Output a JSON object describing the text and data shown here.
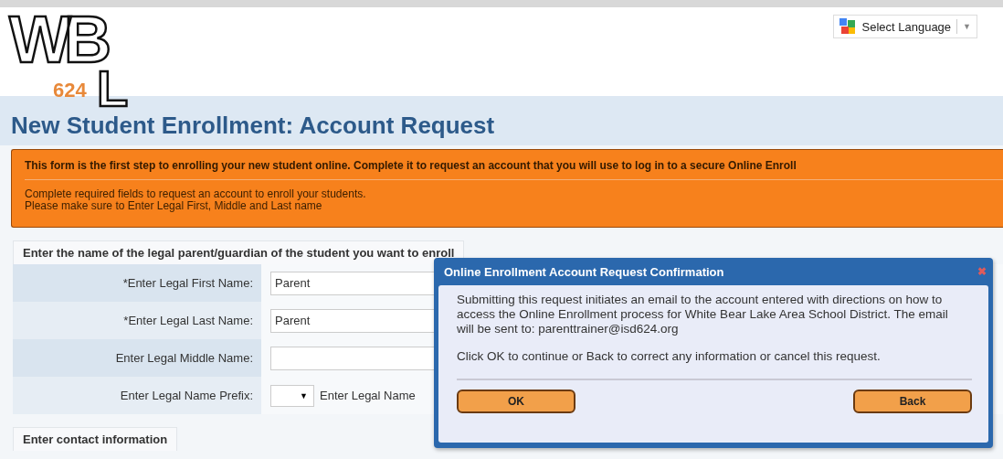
{
  "header": {
    "logo": {
      "top_letters": "WB",
      "bottom_letter": "L",
      "number": "624"
    },
    "language_select": {
      "label": "Select Language",
      "arrow": "▼"
    }
  },
  "title": "New Student Enrollment: Account Request",
  "banner": {
    "headline": "This form is the first step to enrolling your new student online. Complete it to request an account that you will use to log in to a secure Online Enroll",
    "lines": [
      "Complete required fields to request an account to enroll your students.",
      "Please make sure to Enter Legal First, Middle and Last name"
    ]
  },
  "guardian_section": {
    "required_mark": "*",
    "tab": "Enter the name of the legal parent/guardian of the student you want to enroll",
    "rows": [
      {
        "kind": "text",
        "required": true,
        "label": "Enter Legal First Name:",
        "value": "Parent"
      },
      {
        "kind": "text",
        "required": true,
        "label": "Enter Legal Last Name:",
        "value": "Parent"
      },
      {
        "kind": "text",
        "required": false,
        "label": "Enter Legal Middle Name:",
        "value": ""
      },
      {
        "kind": "select",
        "required": false,
        "label": "Enter Legal Name Prefix:",
        "arrow": "▼",
        "after": "Enter Legal Name"
      }
    ]
  },
  "contact_section": {
    "tab": "Enter contact information"
  },
  "dialog": {
    "title": "Online Enrollment Account Request Confirmation",
    "close": "✖",
    "paragraphs": [
      "Submitting this request initiates an email to the account entered with directions on how to access the Online Enrollment process for White Bear Lake Area School District. The email will be sent to: parenttrainer@isd624.org",
      "Click OK to continue or Back to correct any information or cancel this request."
    ],
    "buttons": [
      "OK",
      "Back"
    ]
  }
}
